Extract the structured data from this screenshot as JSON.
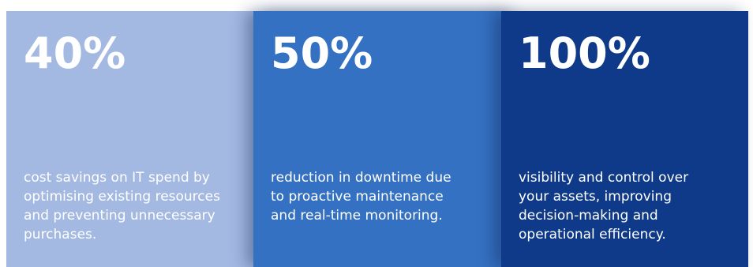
{
  "stats": [
    {
      "value": "40%",
      "description": "cost savings on IT spend by optimising existing resources and preventing unnecessary purchases."
    },
    {
      "value": "50%",
      "description": "reduction in downtime due to proactive maintenance and real-time monitoring."
    },
    {
      "value": "100%",
      "description": "visibility and control over your assets, improving decision-making and operational efficiency."
    }
  ],
  "colors": {
    "card_1": "#a4b9e2",
    "card_2": "#3571c2",
    "card_3": "#0f3a89",
    "text": "#ffffff"
  }
}
